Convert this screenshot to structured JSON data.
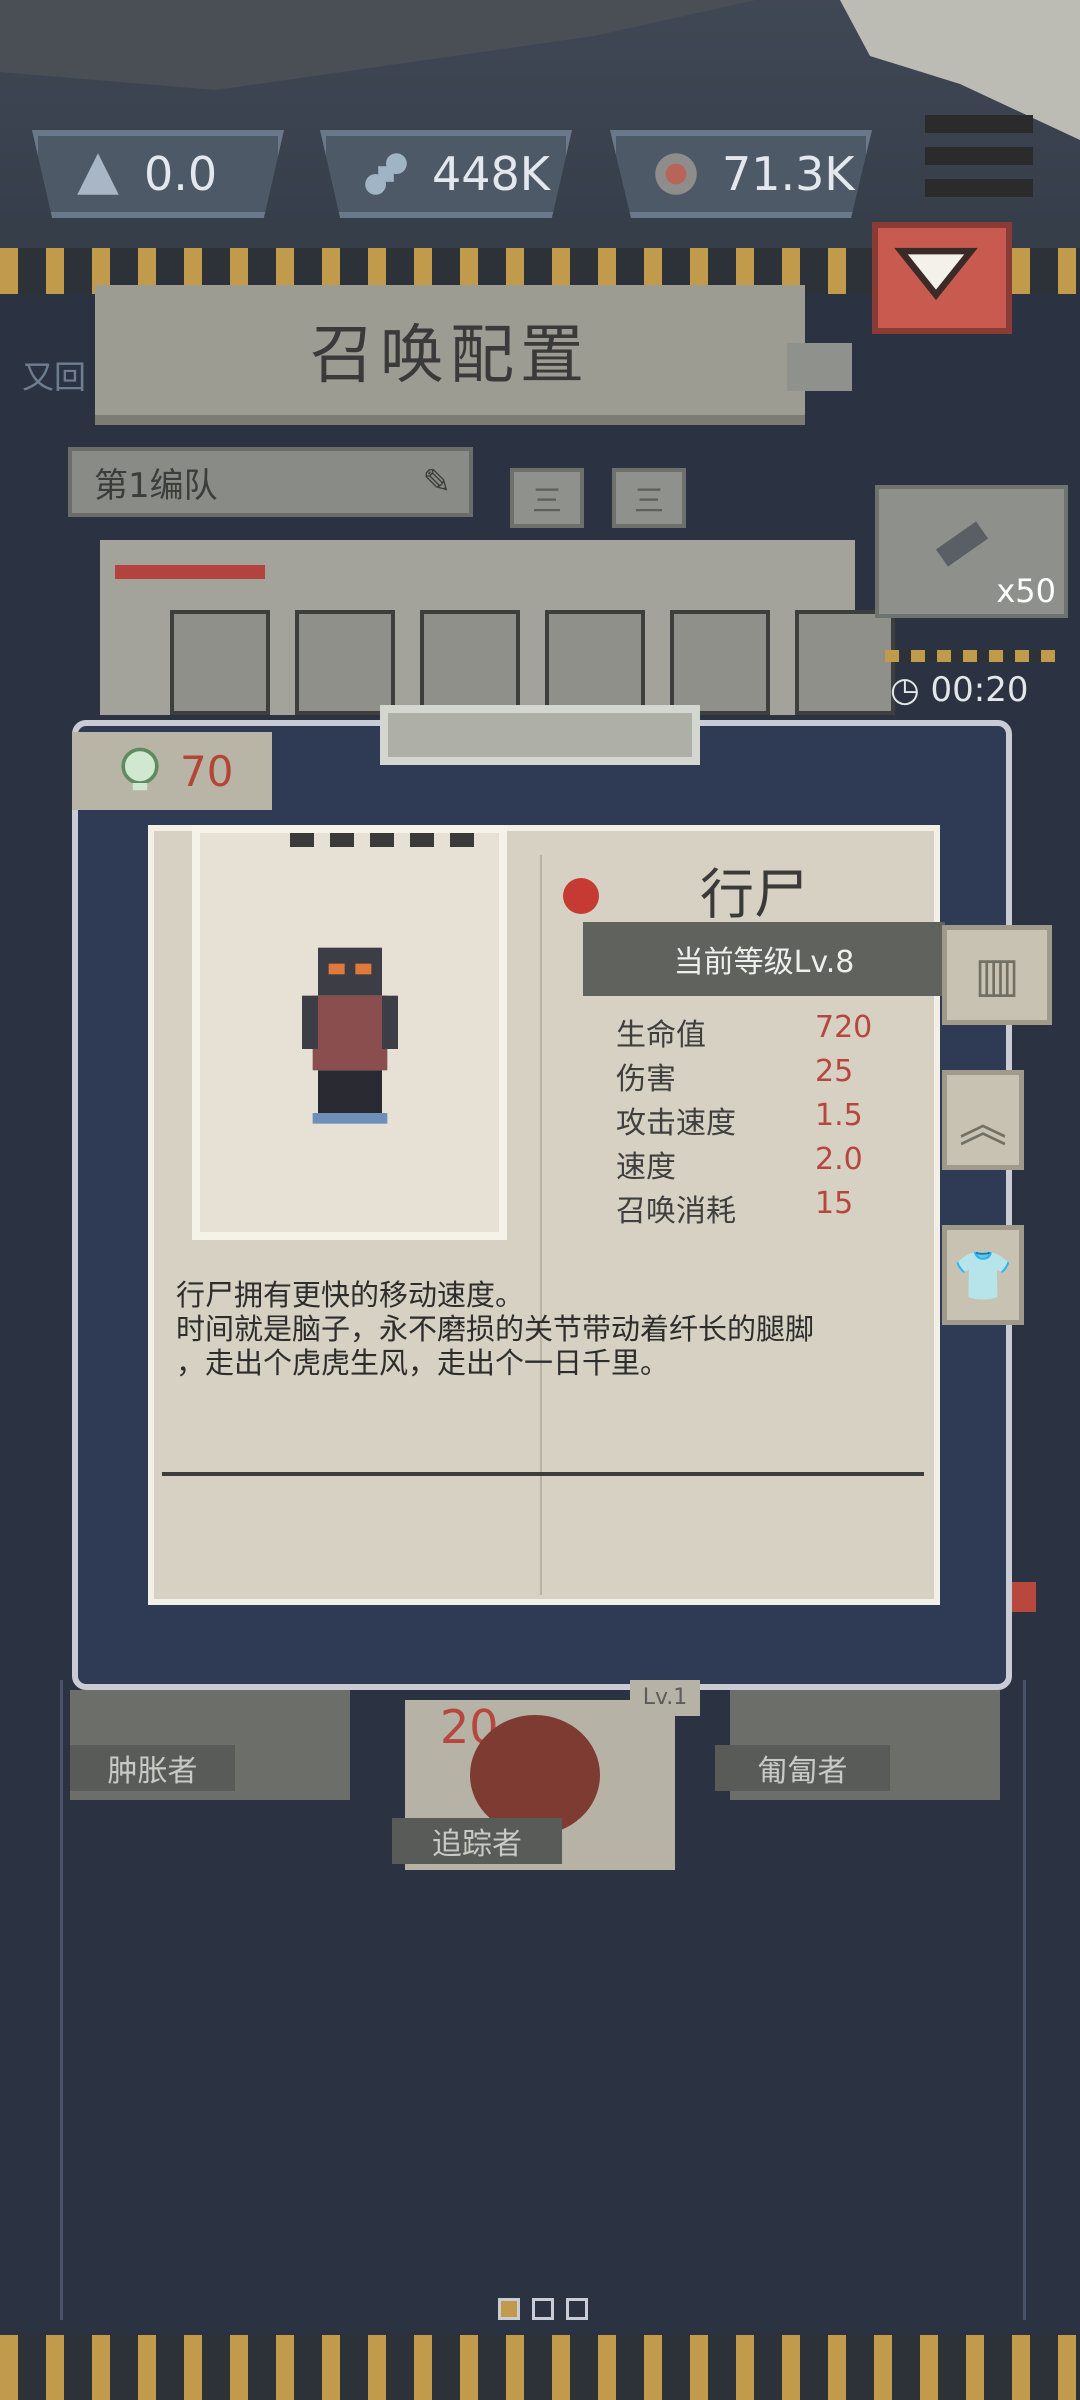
{
  "resources": [
    {
      "icon": "triangle-crystal-icon",
      "value": "0.0"
    },
    {
      "icon": "bones-icon",
      "value": "448K"
    },
    {
      "icon": "brain-icon",
      "value": "71.3K"
    }
  ],
  "header": {
    "title": "召唤配置",
    "left_hint": "又回"
  },
  "team": {
    "name": "第1编队",
    "btn1": "三",
    "btn2": "三"
  },
  "item": {
    "count": "x50"
  },
  "timer": "00:20",
  "soul_count": "70",
  "unit": {
    "name": "行尸",
    "level": "当前等级Lv.8",
    "stats": [
      {
        "label": "生命值",
        "value": "720"
      },
      {
        "label": "伤害",
        "value": "25"
      },
      {
        "label": "攻击速度",
        "value": "1.5"
      },
      {
        "label": "速度",
        "value": "2.0"
      },
      {
        "label": "召唤消耗",
        "value": "15"
      }
    ],
    "desc1": "行尸拥有更快的移动速度。",
    "desc2": "时间就是脑子，永不磨损的关节带动着纤长的腿脚",
    "desc3": "，走出个虎虎生风，走出个一日千里。"
  },
  "units_below": [
    {
      "name": "肿胀者"
    },
    {
      "name": "追踪者",
      "cost": "20"
    },
    {
      "name": "匍匐者",
      "level": "Lv.1"
    }
  ]
}
